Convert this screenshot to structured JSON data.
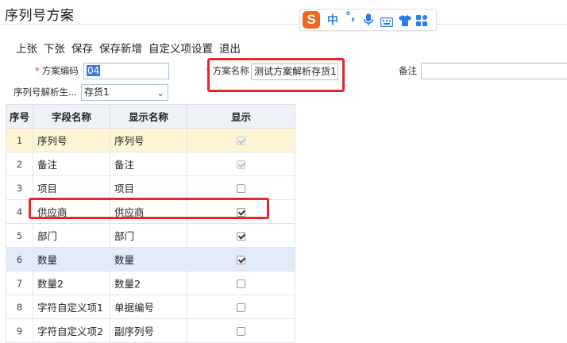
{
  "page": {
    "title": "序列号方案"
  },
  "ime": {
    "logo": "S",
    "mode": "中",
    "punct": "°,"
  },
  "toolbar": {
    "buttons": [
      "上张",
      "下张",
      "保存",
      "保存新增",
      "自定义项设置",
      "退出"
    ]
  },
  "form": {
    "scheme_code": {
      "label": "方案编码",
      "required": true,
      "value": "04"
    },
    "scheme_name": {
      "label": "方案名称",
      "required": true,
      "value": "测试方案解析存货1"
    },
    "remark": {
      "label": "备注",
      "value": ""
    },
    "parser": {
      "label": "序列号解析生...",
      "value": "存货1"
    }
  },
  "grid": {
    "headers": [
      "序号",
      "字段名称",
      "显示名称",
      "显示"
    ],
    "rows": [
      {
        "no": "1",
        "field": "序列号",
        "display": "序列号",
        "checked": true,
        "disabled": true
      },
      {
        "no": "2",
        "field": "备注",
        "display": "备注",
        "checked": true,
        "disabled": true
      },
      {
        "no": "3",
        "field": "项目",
        "display": "项目",
        "checked": false,
        "disabled": false
      },
      {
        "no": "4",
        "field": "供应商",
        "display": "供应商",
        "checked": true,
        "disabled": false
      },
      {
        "no": "5",
        "field": "部门",
        "display": "部门",
        "checked": true,
        "disabled": false
      },
      {
        "no": "6",
        "field": "数量",
        "display": "数量",
        "checked": true,
        "disabled": false
      },
      {
        "no": "7",
        "field": "数量2",
        "display": "数量2",
        "checked": false,
        "disabled": false
      },
      {
        "no": "8",
        "field": "字符自定义项1",
        "display": "单据编号",
        "checked": false,
        "disabled": false
      },
      {
        "no": "9",
        "field": "字符自定义项2",
        "display": "副序列号",
        "checked": false,
        "disabled": false
      }
    ]
  },
  "colors": {
    "highlight_box": "#e5262a",
    "row_selected": "#fff5d4",
    "row_hover": "#e1ecf8",
    "ime_brand": "#f2671d",
    "ime_blue": "#2b7ce9"
  }
}
